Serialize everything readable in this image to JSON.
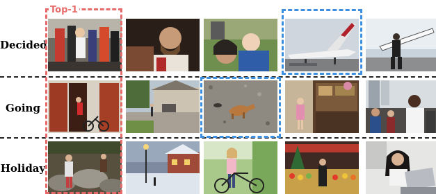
{
  "figure": {
    "top_label": "Top-1",
    "rows": [
      {
        "label": "Decided",
        "images": [
          {
            "scene": "crowd-street-celebration"
          },
          {
            "scene": "bearded-man-portrait"
          },
          {
            "scene": "woman-with-baby"
          },
          {
            "scene": "jet-airplane-on-runway"
          },
          {
            "scene": "surfer-on-beach"
          }
        ]
      },
      {
        "label": "Going",
        "images": [
          {
            "scene": "red-doors-bicycle"
          },
          {
            "scene": "suburban-driveway"
          },
          {
            "scene": "dog-on-gravel"
          },
          {
            "scene": "girl-in-market-shop"
          },
          {
            "scene": "man-in-crowd-street"
          }
        ]
      },
      {
        "label": "Holiday",
        "images": [
          {
            "scene": "hikers-on-rocks"
          },
          {
            "scene": "snowy-street-dusk"
          },
          {
            "scene": "woman-with-bicycle"
          },
          {
            "scene": "christmas-market-stalls"
          },
          {
            "scene": "woman-at-laptop"
          }
        ]
      }
    ],
    "highlights": [
      {
        "row": 0,
        "col": 0,
        "color": "red"
      },
      {
        "row": 1,
        "col": 0,
        "color": "red"
      },
      {
        "row": 2,
        "col": 0,
        "color": "red"
      },
      {
        "row": 0,
        "col": 3,
        "color": "blue"
      },
      {
        "row": 1,
        "col": 2,
        "color": "blue"
      }
    ],
    "colors": {
      "top1_highlight": "#e76b6b",
      "alt_highlight": "#3d8fe0",
      "separator": "#222222"
    }
  }
}
